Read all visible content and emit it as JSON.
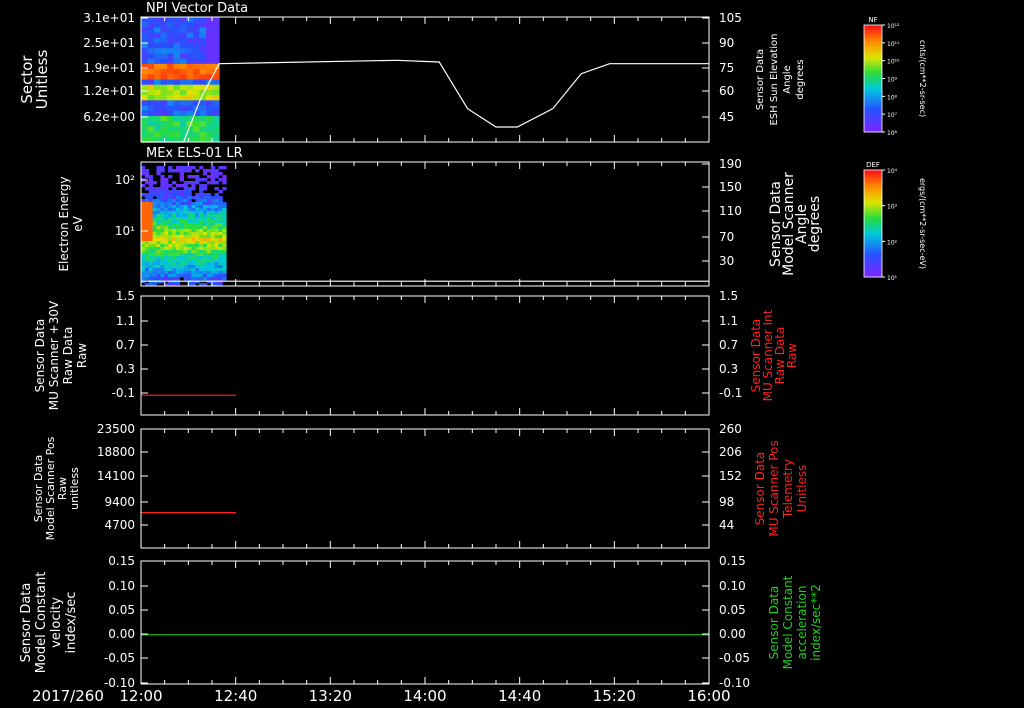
{
  "chart_data": [
    {
      "type": "heatmap",
      "title": "NPI Vector Data",
      "ylabel_left": [
        "Sector",
        "Unitless"
      ],
      "yticks_left": [
        "3.1e+01",
        "2.5e+01",
        "1.9e+01",
        "1.2e+01",
        "6.2e+00"
      ],
      "ylabel_right": [
        "Sensor Data",
        "ESH Sun Elevation",
        "Angle",
        "degrees"
      ],
      "yticks_right": [
        "105",
        "90",
        "75",
        "60",
        "45"
      ],
      "ylim_right": [
        30,
        105
      ],
      "overlay_line": {
        "x_hours": [
          12.0,
          12.3,
          12.42,
          12.55,
          13.8,
          14.1,
          14.3,
          14.5,
          14.65,
          14.9,
          15.1,
          15.3,
          16.0
        ],
        "values": [
          30,
          30,
          56,
          77,
          79,
          78,
          50,
          39,
          39,
          50,
          71,
          77,
          77
        ]
      },
      "data_x_range_hours": [
        12.0,
        12.55
      ],
      "colorbar": {
        "label": "NF",
        "unit": "cnts/(cm**2-sr-sec)",
        "ticks": [
          "10¹²",
          "10¹¹",
          "10¹⁰",
          "10⁹",
          "10⁸",
          "10⁷",
          "10⁶"
        ]
      }
    },
    {
      "type": "heatmap",
      "title": "MEx ELS-01 LR",
      "ylabel_left": [
        "Electron Energy",
        "eV"
      ],
      "yticks_left": [
        "10²",
        "10¹"
      ],
      "ylabel_right": [
        "Sensor Data",
        "Model Scanner",
        "Angle",
        "degrees"
      ],
      "yticks_right": [
        "190",
        "150",
        "110",
        "70",
        "30"
      ],
      "ylim_right": [
        10,
        190
      ],
      "overlay_line": {
        "x_hours": [
          12.0,
          16.0
        ],
        "values": [
          17,
          17
        ]
      },
      "data_x_range_hours": [
        12.0,
        12.6
      ],
      "colorbar": {
        "label": "DEF",
        "unit": "ergs/(cm**2-sr-sec-eV)",
        "ticks": [
          "10⁴",
          "10³",
          "10²",
          "10¹"
        ]
      }
    },
    {
      "type": "line",
      "ylabel_left": [
        "Sensor Data",
        "MU Scanner +30V",
        "Raw Data",
        "Raw"
      ],
      "yticks_left": [
        "1.5",
        "1.1",
        "0.7",
        "0.3",
        "-0.1"
      ],
      "ylim": [
        -0.3,
        1.5
      ],
      "ylabel_right": [
        "Sensor Data",
        "MU Scanner Int",
        "Raw Data",
        "Raw"
      ],
      "yticks_right": [
        "1.5",
        "1.1",
        "0.7",
        "0.3",
        "-0.1"
      ],
      "series": [
        {
          "x_hours": [
            12.0,
            12.67
          ],
          "values": [
            0,
            0
          ],
          "color": "#ff2020"
        }
      ]
    },
    {
      "type": "line",
      "ylabel_left": [
        "Sensor Data",
        "Model Scanner Pos",
        "Raw",
        "unitless"
      ],
      "yticks_left": [
        "23500",
        "18800",
        "14100",
        "9400",
        "4700"
      ],
      "ylim": [
        0,
        23500
      ],
      "ylabel_right": [
        "Sensor Data",
        "MU Scanner Pos",
        "Telemetry",
        "Unitless"
      ],
      "yticks_right": [
        "260",
        "206",
        "152",
        "98",
        "44"
      ],
      "series": [
        {
          "x_hours": [
            12.0,
            12.67
          ],
          "values": [
            7000,
            7000
          ],
          "color": "#ff2020"
        }
      ]
    },
    {
      "type": "line",
      "ylabel_left": [
        "Sensor Data",
        "Model Constant",
        "velocity",
        "index/sec"
      ],
      "yticks_left": [
        "0.15",
        "0.10",
        "0.05",
        "0.00",
        "-0.05",
        "-0.10"
      ],
      "ylim": [
        -0.1,
        0.15
      ],
      "ylabel_right": [
        "Sensor Data",
        "Model Constant",
        "acceleration",
        "index/sec**2"
      ],
      "yticks_right": [
        "0.15",
        "0.10",
        "0.05",
        "0.00",
        "-0.05",
        "-0.10"
      ],
      "series": [
        {
          "x_hours": [
            12.0,
            16.0
          ],
          "values": [
            0,
            0
          ],
          "color": "#20d020"
        }
      ]
    }
  ],
  "x_axis": {
    "date_label": "2017/260",
    "ticks": [
      "12:00",
      "12:40",
      "13:20",
      "14:00",
      "14:40",
      "15:20",
      "16:00"
    ],
    "tick_hours": [
      12.0,
      12.667,
      13.333,
      14.0,
      14.667,
      15.333,
      16.0
    ],
    "xlim_hours": [
      12.0,
      16.0
    ]
  },
  "colors": {
    "background": "#000000",
    "axes": "#ffffff",
    "red": "#ff2020",
    "green": "#20d020"
  }
}
